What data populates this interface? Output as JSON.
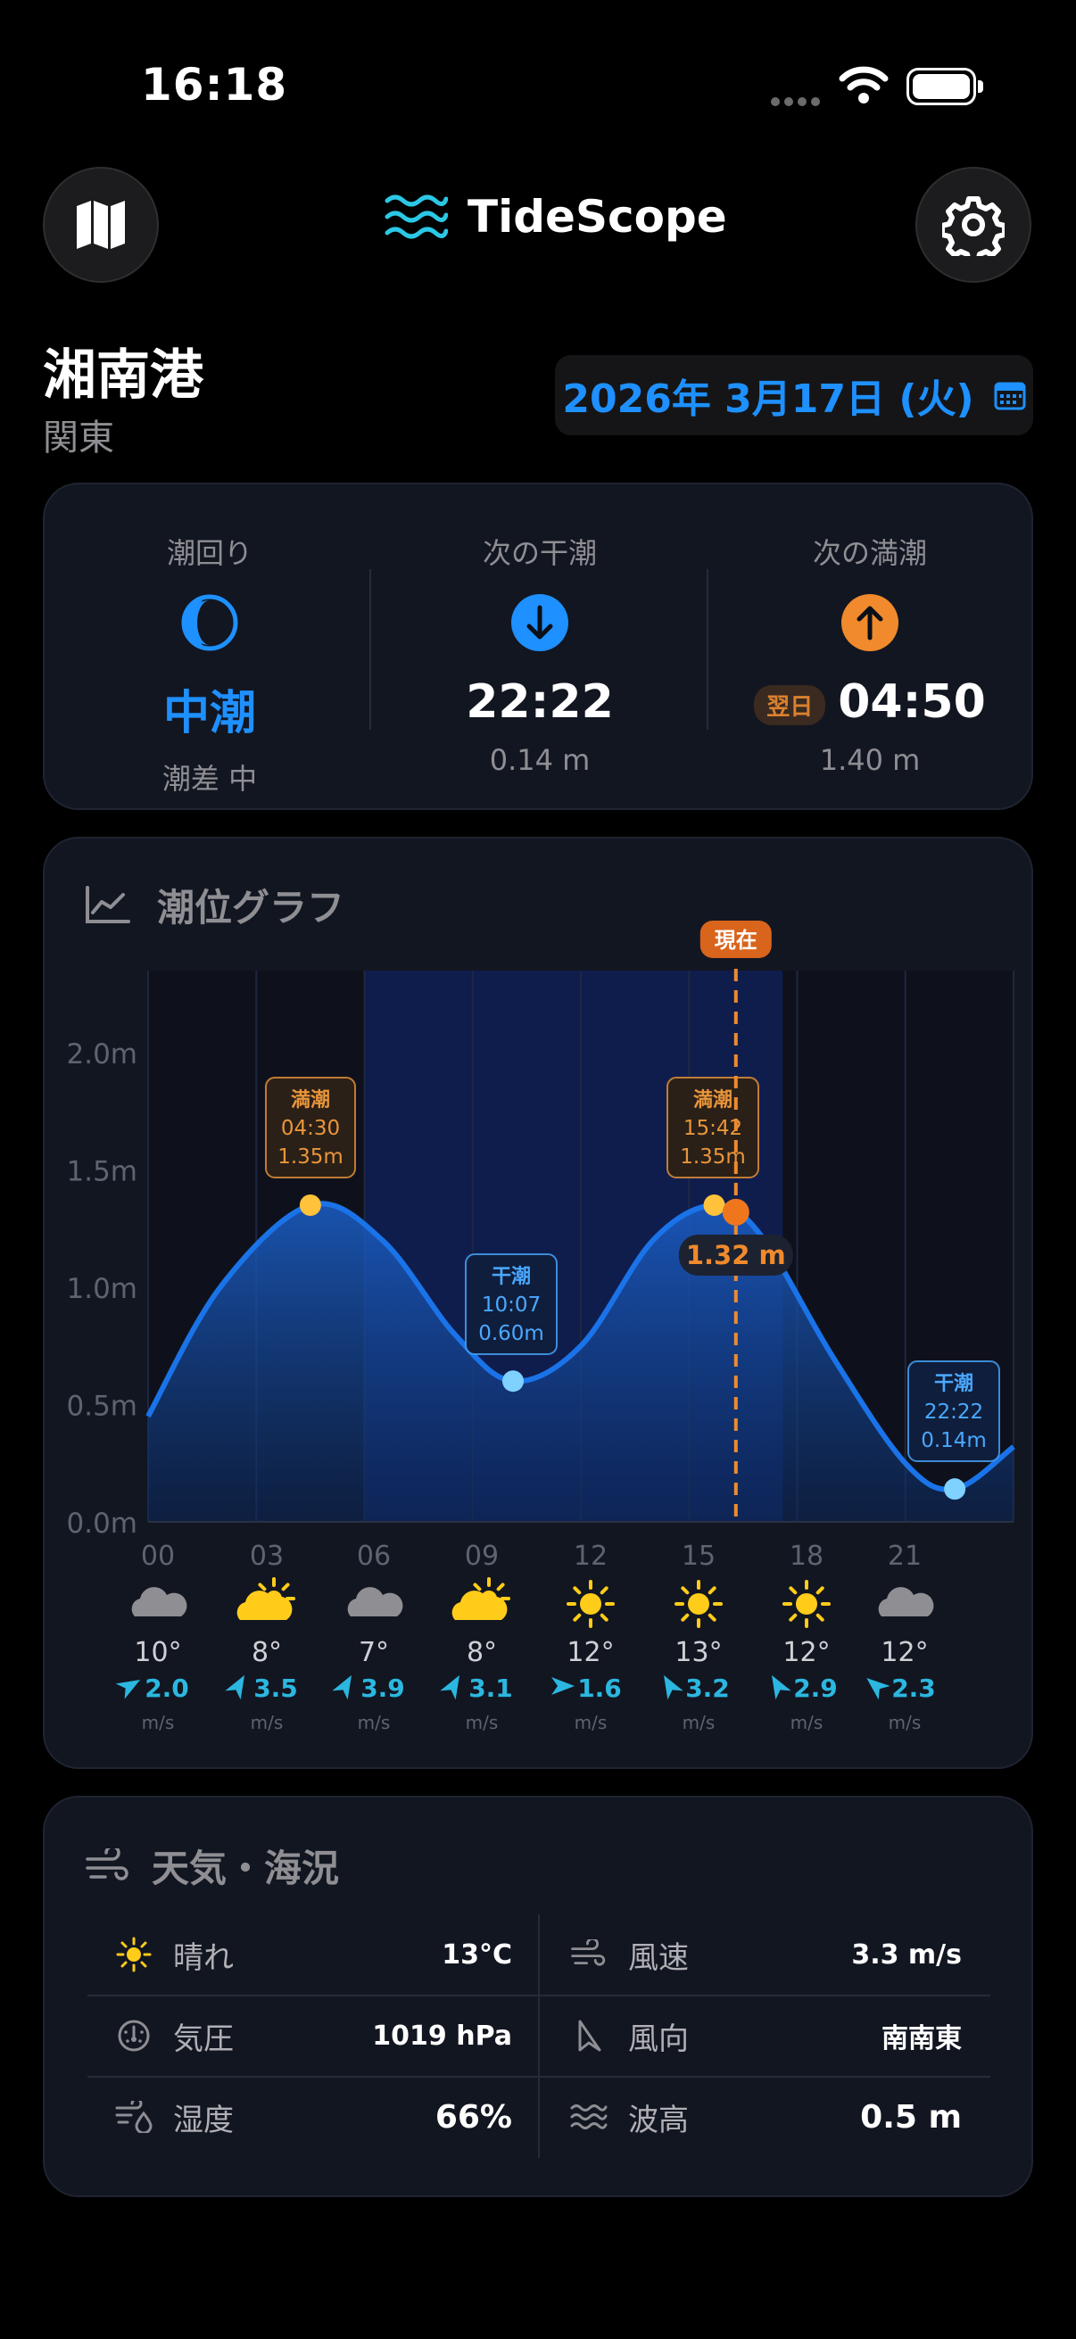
{
  "status_bar": {
    "time": "16:18"
  },
  "header": {
    "app_name": "TideScope",
    "map_icon": "map-icon",
    "settings_icon": "gear-icon"
  },
  "location": {
    "name": "湘南港",
    "region": "関東",
    "date": "2026年 3月17日 (火)"
  },
  "summary": {
    "tide_cycle": {
      "label": "潮回り",
      "value": "中潮",
      "sub": "潮差 中"
    },
    "next_low": {
      "label": "次の干潮",
      "time": "22:22",
      "height": "0.14 m"
    },
    "next_high": {
      "label": "次の満潮",
      "badge": "翌日",
      "time": "04:50",
      "height": "1.40 m"
    }
  },
  "chart_card": {
    "title": "潮位グラフ",
    "now_label": "現在",
    "now_value": "1.32 m",
    "hour_labels": [
      "00",
      "03",
      "06",
      "09",
      "12",
      "15",
      "18",
      "21"
    ],
    "annotations": {
      "high1": {
        "label": "満潮",
        "time": "04:30",
        "height": "1.35m"
      },
      "low1": {
        "label": "干潮",
        "time": "10:07",
        "height": "0.60m"
      },
      "high2": {
        "label": "満潮",
        "time": "15:42",
        "height": "1.35m"
      },
      "low2": {
        "label": "干潮",
        "time": "22:22",
        "height": "0.14m"
      }
    },
    "forecast": [
      {
        "icon": "cloud",
        "temp": "10°",
        "wind": "2.0",
        "unit": "m/s",
        "dir": 60
      },
      {
        "icon": "partly-sunny",
        "temp": "8°",
        "wind": "3.5",
        "unit": "m/s",
        "dir": 30
      },
      {
        "icon": "cloud",
        "temp": "7°",
        "wind": "3.9",
        "unit": "m/s",
        "dir": 30
      },
      {
        "icon": "partly-sunny",
        "temp": "8°",
        "wind": "3.1",
        "unit": "m/s",
        "dir": 30
      },
      {
        "icon": "sun",
        "temp": "12°",
        "wind": "1.6",
        "unit": "m/s",
        "dir": 90
      },
      {
        "icon": "sun",
        "temp": "13°",
        "wind": "3.2",
        "unit": "m/s",
        "dir": -30
      },
      {
        "icon": "sun",
        "temp": "12°",
        "wind": "2.9",
        "unit": "m/s",
        "dir": -30
      },
      {
        "icon": "cloud",
        "temp": "12°",
        "wind": "2.3",
        "unit": "m/s",
        "dir": -50
      }
    ]
  },
  "chart_data": {
    "type": "area",
    "title": "潮位グラフ",
    "xlabel": "",
    "ylabel": "",
    "x_ticks": [
      "00",
      "03",
      "06",
      "09",
      "12",
      "15",
      "18",
      "21"
    ],
    "y_ticks": [
      "0.0m",
      "0.5m",
      "1.0m",
      "1.5m",
      "2.0m"
    ],
    "xlim": [
      0,
      24
    ],
    "ylim": [
      0,
      2.35
    ],
    "series": [
      {
        "x": [
          0,
          2,
          4.5,
          6.5,
          8.5,
          10.12,
          12,
          14,
          15.7,
          17,
          19,
          21,
          22.37,
          24
        ],
        "y": [
          0.45,
          1.0,
          1.35,
          1.2,
          0.8,
          0.6,
          0.75,
          1.2,
          1.35,
          1.22,
          0.7,
          0.25,
          0.14,
          0.32
        ]
      }
    ],
    "points": [
      {
        "x": 4.5,
        "y": 1.35,
        "kind": "high"
      },
      {
        "x": 10.12,
        "y": 0.6,
        "kind": "low"
      },
      {
        "x": 15.7,
        "y": 1.35,
        "kind": "high"
      },
      {
        "x": 22.37,
        "y": 0.14,
        "kind": "low"
      }
    ],
    "current": {
      "x": 16.3,
      "y": 1.32
    },
    "daylight": [
      6,
      17.6
    ],
    "grid": true
  },
  "weather_card": {
    "title": "天気・海況",
    "condition": {
      "label": "晴れ",
      "value": "13°C"
    },
    "wind_speed": {
      "label": "風速",
      "value": "3.3 m/s"
    },
    "pressure": {
      "label": "気圧",
      "value": "1019 hPa"
    },
    "wind_dir": {
      "label": "風向",
      "value": "南南東"
    },
    "humidity": {
      "label": "湿度",
      "value": "66%"
    },
    "wave": {
      "label": "波高",
      "value": "0.5 m"
    }
  },
  "colors": {
    "accent_blue": "#1e90ff",
    "accent_orange": "#f08a2c",
    "cyan": "#2bc8e6",
    "sun": "#ffcc1a"
  }
}
